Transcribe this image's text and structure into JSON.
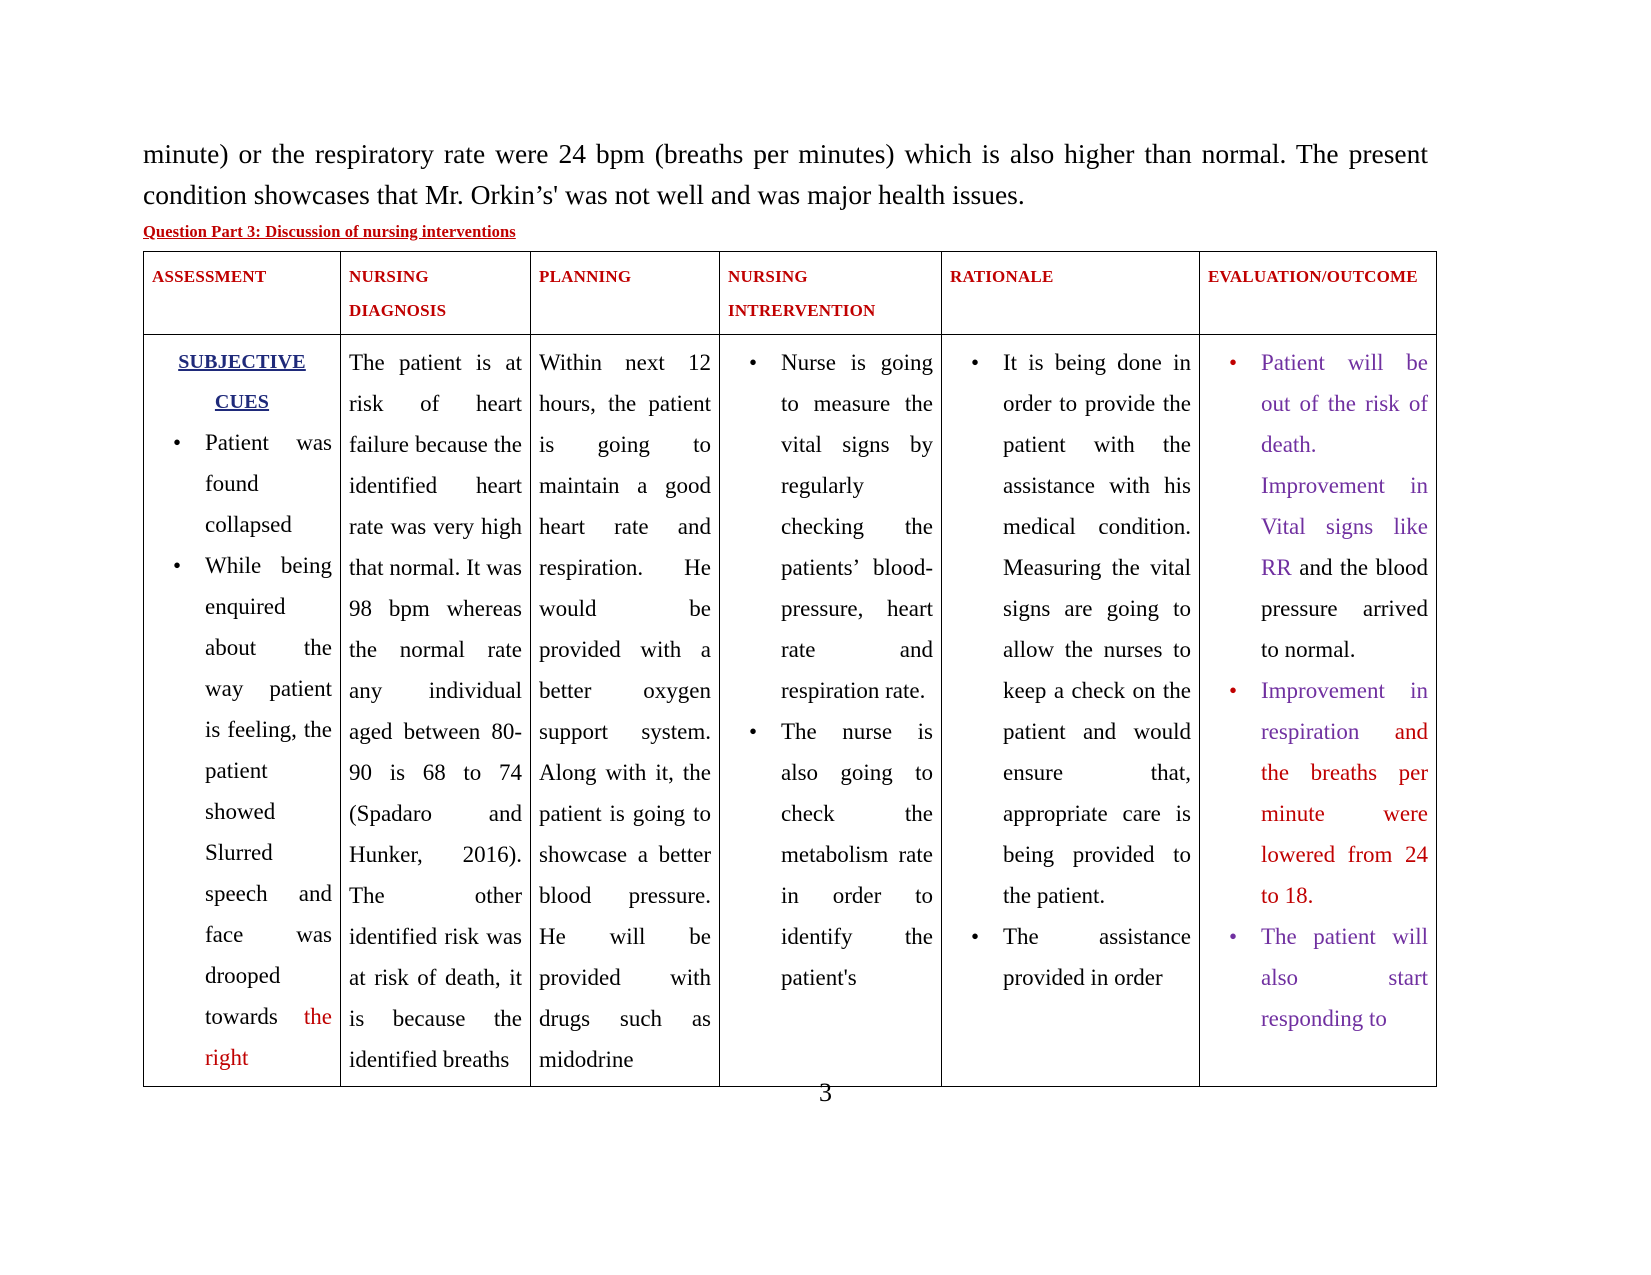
{
  "document": {
    "paragraph_top": "minute) or the respiratory rate were 24 bpm (breaths per minutes) which is also higher than normal. The present condition showcases that Mr. Orkin’s' was not well and was major health issues.",
    "section_heading": "Question Part 3: Discussion of nursing interventions",
    "page_number": "3"
  },
  "colors": {
    "heading_red": "#C00000",
    "subjective_blue": "#1F2A7A",
    "outcome_purple": "#7030A0",
    "outcome_red": "#C00000",
    "table_border": "#000000"
  },
  "table": {
    "headers": [
      "ASSESSMENT",
      "NURSING DIAGNOSIS",
      "PLANNING",
      "NURSING INTRERVENTION",
      "RATIONALE",
      "EVALUATION/OUTCOME"
    ],
    "header_nursing_intervention_line1": "NURSING",
    "header_nursing_intervention_line2": "INTRERVENTION",
    "assessment": {
      "subheading": "SUBJECTIVE CUES",
      "bullets": [
        "Patient was found collapsed",
        "While being enquired about the way patient is feeling, the patient showed Slurred speech and face was drooped towards ",
        "the right"
      ],
      "bullet2_black_part": "While being enquired about the way patient is feeling, the patient showed Slurred speech and face was drooped towards",
      "bullet2_red_part": "to the right"
    },
    "nursing_diagnosis": "The patient is at risk of heart failure because the identified heart rate was very high that normal. It was 98 bpm whereas the normal rate any individual aged between 80-90 is 68 to 74 (Spadaro and Hunker, 2016). The other identified risk was at risk of death, it is because the identified breaths",
    "planning": "Within next 12 hours, the patient is going to maintain a good heart rate and respiration. He would be provided with a better oxygen support system. Along with it, the patient is going to showcase a better blood pressure. He will be provided with drugs such as midodrine",
    "nursing_intervention": [
      "Nurse is going to measure the vital signs by regularly checking the patients’ blood-pressure, heart rate and respiration rate.",
      "The nurse is also going to check the metabolism rate in order to identify the patient's"
    ],
    "rationale": [
      "It is being done in order to provide the patient with the assistance with his medical condition. Measuring the vital signs are going to allow the nurses to keep a check on the patient and would ensure that, appropriate care is being provided to the patient.",
      "The assistance provided in order"
    ],
    "evaluation_outcome": [
      {
        "purple_part": "Patient will be out of the risk of death. Improvement in Vital signs like RR",
        "black_part": "and the blood pressure arrived to normal."
      },
      {
        "purple_part": "Improvement in respiration",
        "red_part": "and the breaths per minute were lowered from 24 to 18."
      },
      {
        "purple_part": "The patient will also start responding to"
      }
    ]
  }
}
